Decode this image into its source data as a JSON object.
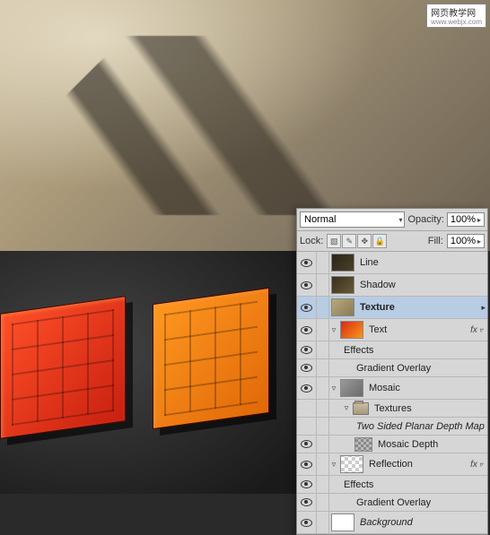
{
  "watermark": {
    "title": "网页教学网",
    "url": "www.webjx.com"
  },
  "panel": {
    "blend_mode": "Normal",
    "opacity_label": "Opacity:",
    "opacity_value": "100%",
    "lock_label": "Lock:",
    "fill_label": "Fill:",
    "fill_value": "100%"
  },
  "fx_label": "fx",
  "layers": {
    "line": "Line",
    "shadow": "Shadow",
    "texture": "Texture",
    "text": "Text",
    "effects": "Effects",
    "gradient_overlay": "Gradient Overlay",
    "mosaic": "Mosaic",
    "textures": "Textures",
    "two_sided": "Two Sided Planar Depth Map",
    "mosaic_depth": "Mosaic Depth",
    "reflection": "Reflection",
    "background": "Background"
  }
}
